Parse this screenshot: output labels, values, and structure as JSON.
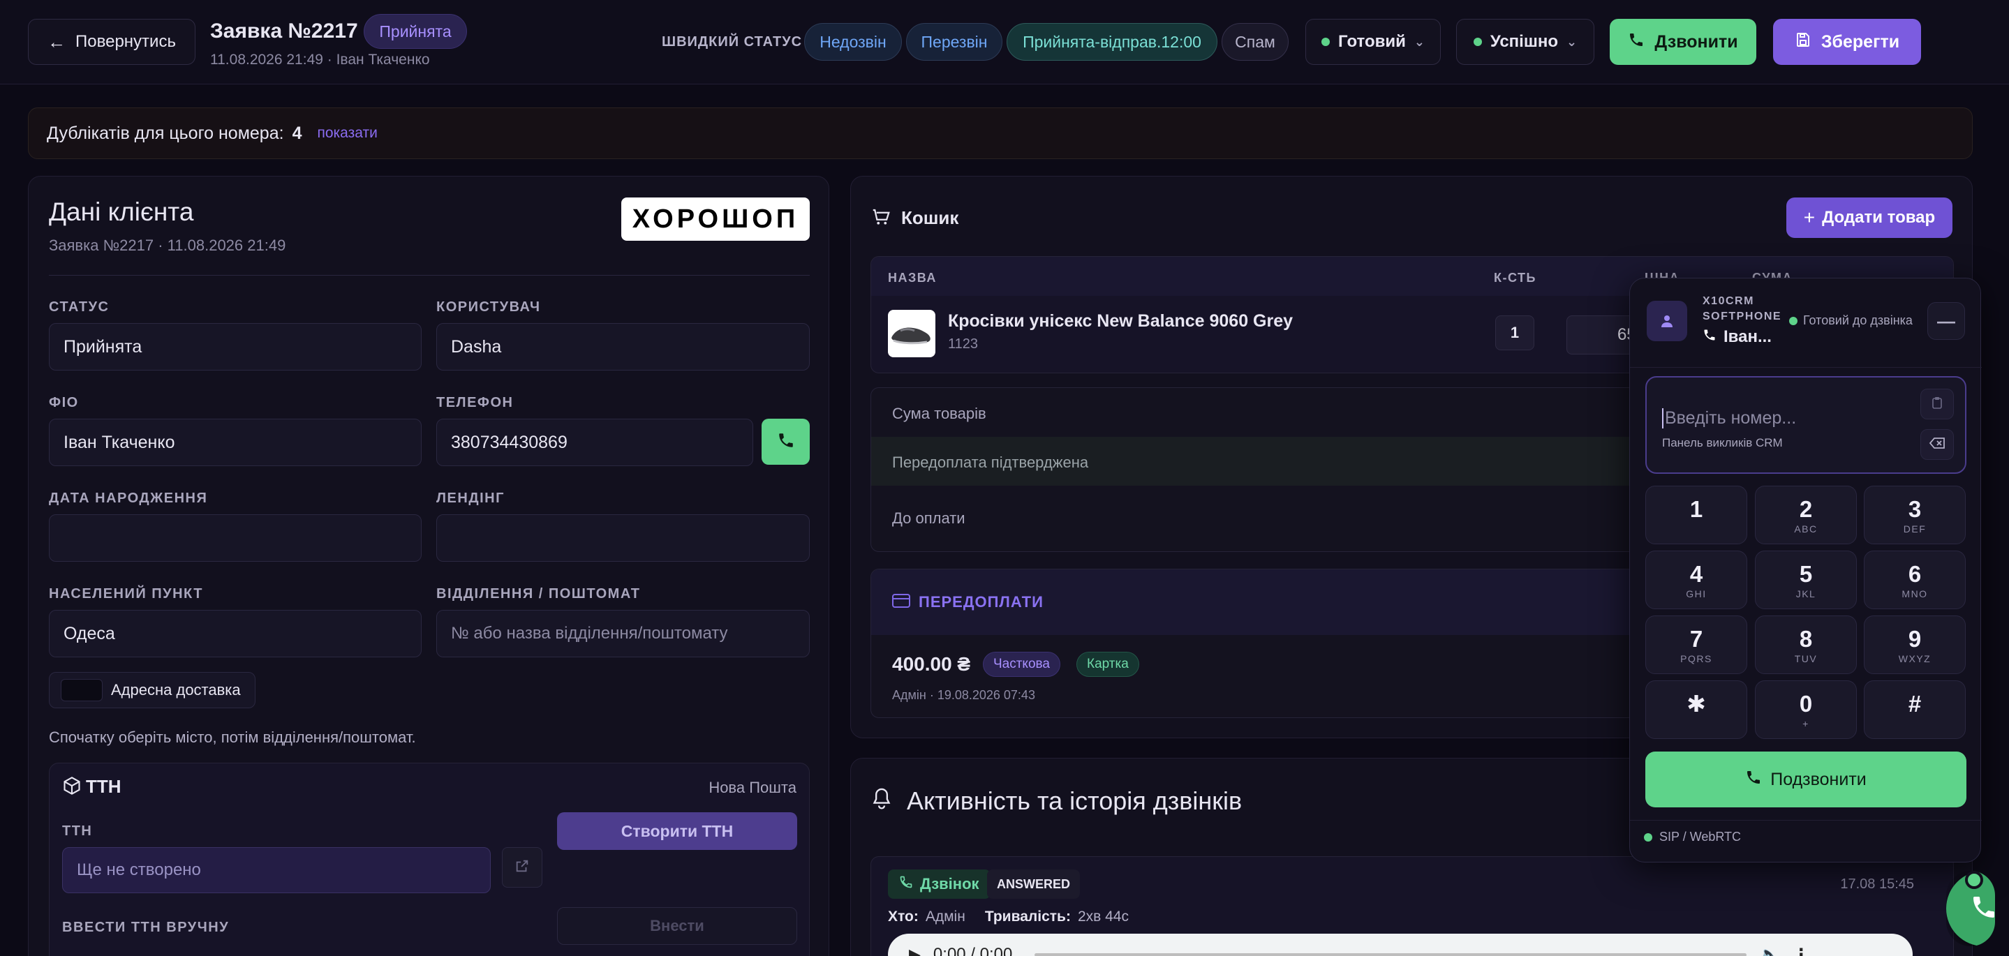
{
  "header": {
    "back_label": "Повернутись",
    "title": "Заявка №2217",
    "status_badge": "Прийнята",
    "subtitle": "11.08.2026 21:49 · Іван Ткаченко",
    "quick_status_label": "ШВИДКИЙ СТАТУС",
    "quick_statuses": [
      "Недозвін",
      "Перезвін",
      "Прийнята-відправ.12:00",
      "Спам"
    ],
    "ready_select": "Готовий",
    "result_select": "Успішно",
    "call_label": "Дзвонити",
    "save_label": "Зберегти"
  },
  "duplicates": {
    "text": "Дублікатів для цього номера:",
    "count": "4",
    "link": "показати"
  },
  "client": {
    "title": "Дані клієнта",
    "subtitle": "Заявка №2217 · 11.08.2026 21:49",
    "logo": "ХОРОШОП",
    "status_label": "СТАТУС",
    "status_value": "Прийнята",
    "user_label": "КОРИСТУВАЧ",
    "user_value": "Dasha",
    "name_label": "ФІО",
    "name_value": "Іван Ткаченко",
    "phone_label": "ТЕЛЕФОН",
    "phone_value": "380734430869",
    "birth_label": "ДАТА НАРОДЖЕННЯ",
    "birth_value": "",
    "landing_label": "ЛЕНДІНГ",
    "landing_value": "",
    "city_label": "НАСЕЛЕНИЙ ПУНКТ",
    "city_value": "Одеса",
    "branch_label": "ВІДДІЛЕННЯ / ПОШТОМАТ",
    "branch_placeholder": "№ або назва відділення/поштомату",
    "address_delivery": "Адресна доставка",
    "hint": "Спочатку оберіть місто, потім відділення/поштомат."
  },
  "ttn": {
    "title": "ТТН",
    "carrier": "Нова Пошта",
    "field_label": "ТТН",
    "placeholder": "Ще не створено",
    "create_label": "Створити ТТН",
    "manual_label": "ВВЕСТИ ТТН ВРУЧНУ",
    "enter_label": "Внести"
  },
  "cart": {
    "title": "Кошик",
    "add_label": "Додати товар",
    "columns": [
      "НАЗВА",
      "К-СТЬ",
      "ЦІНА",
      "СУМА"
    ],
    "item": {
      "name": "Кросівки унісекс New Balance 9060 Grey",
      "sku": "1123",
      "qty": "1",
      "price": "659"
    },
    "sum_label": "Сума товарів",
    "prepaid_label": "Передоплата підтверджена",
    "due_label": "До оплати"
  },
  "prepayments": {
    "title": "ПЕРЕДОПЛАТИ",
    "amount": "400.00 ₴",
    "tag1": "Часткова",
    "tag2": "Картка",
    "meta": "Адмін · 19.08.2026 07:43"
  },
  "activity": {
    "title": "Активність та історія дзвінків",
    "call_tag": "Дзвінок",
    "call_status": "ANSWERED",
    "date": "17.08 15:45",
    "who_label": "Хто:",
    "who_value": "Адмін",
    "dur_label": "Тривалість:",
    "dur_value": "2хв 44с",
    "player_time": "0:00 / 0:00"
  },
  "softphone": {
    "brand_line1": "X10CRM",
    "brand_line2": "SOFTPHONE",
    "status": "Готовий до дзвінка",
    "user": "Іван...",
    "placeholder": "Введіть номер...",
    "panel_label": "Панель викликів CRM",
    "keys": [
      {
        "d": "1",
        "s": ""
      },
      {
        "d": "2",
        "s": "ABC"
      },
      {
        "d": "3",
        "s": "DEF"
      },
      {
        "d": "4",
        "s": "GHI"
      },
      {
        "d": "5",
        "s": "JKL"
      },
      {
        "d": "6",
        "s": "MNO"
      },
      {
        "d": "7",
        "s": "PQRS"
      },
      {
        "d": "8",
        "s": "TUV"
      },
      {
        "d": "9",
        "s": "WXYZ"
      },
      {
        "d": "✱",
        "s": ""
      },
      {
        "d": "0",
        "s": "+"
      },
      {
        "d": "#",
        "s": ""
      }
    ],
    "call_label": "Подзвонити",
    "footer": "SIP / WebRTC"
  },
  "colors": {
    "accent": "#7c5ce0",
    "green": "#5ed38a",
    "bg": "#0c0a16"
  }
}
